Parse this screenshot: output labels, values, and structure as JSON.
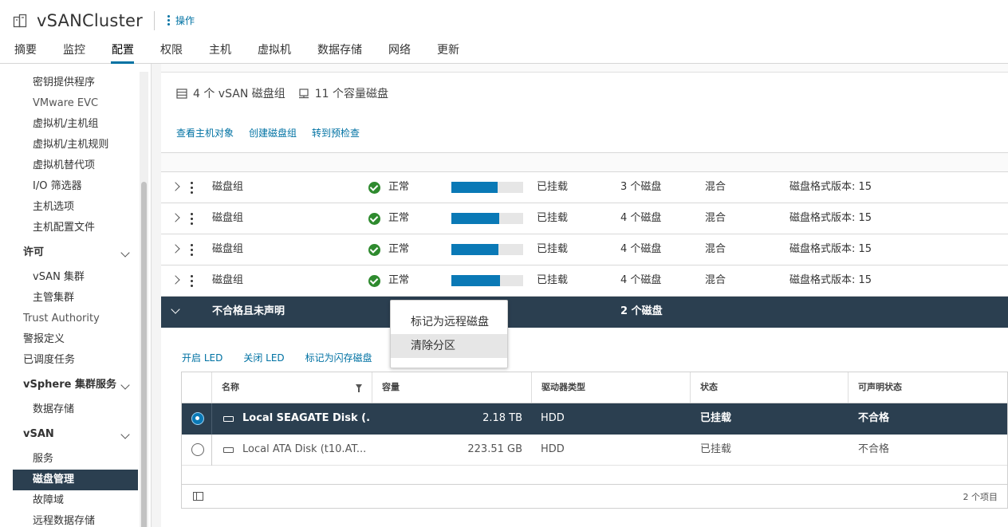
{
  "header": {
    "title": "vSANCluster",
    "actions_label": "操作",
    "tabs": [
      "摘要",
      "监控",
      "配置",
      "权限",
      "主机",
      "虚拟机",
      "数据存储",
      "网络",
      "更新"
    ],
    "active_tab": "配置"
  },
  "nav": {
    "items": [
      {
        "label": "密钥提供程序"
      },
      {
        "label": "VMware EVC"
      },
      {
        "label": "虚拟机/主机组"
      },
      {
        "label": "虚拟机/主机规则"
      },
      {
        "label": "虚拟机替代项"
      },
      {
        "label": "I/O 筛选器"
      },
      {
        "label": "主机选项"
      },
      {
        "label": "主机配置文件"
      },
      {
        "label": "许可"
      },
      {
        "label": "vSAN 集群"
      },
      {
        "label": "主管集群"
      },
      {
        "label": "Trust Authority"
      },
      {
        "label": "警报定义"
      },
      {
        "label": "已调度任务"
      },
      {
        "label": "vSphere 集群服务"
      },
      {
        "label": "数据存储"
      },
      {
        "label": "vSAN"
      },
      {
        "label": "服务"
      },
      {
        "label": "磁盘管理"
      },
      {
        "label": "故障域"
      },
      {
        "label": "远程数据存储"
      }
    ]
  },
  "summary": {
    "disk_groups": "4 个 vSAN 磁盘组",
    "capacity_disks": "11 个容量磁盘",
    "links": [
      "查看主机对象",
      "创建磁盘组",
      "转到预检查"
    ]
  },
  "disk_groups": [
    {
      "name": "磁盘组",
      "status": "正常",
      "usage": 0.64,
      "mounted": "已挂载",
      "disks": "3 个磁盘",
      "type": "混合",
      "format": "磁盘格式版本: 15"
    },
    {
      "name": "磁盘组",
      "status": "正常",
      "usage": 0.67,
      "mounted": "已挂载",
      "disks": "4 个磁盘",
      "type": "混合",
      "format": "磁盘格式版本: 15"
    },
    {
      "name": "磁盘组",
      "status": "正常",
      "usage": 0.66,
      "mounted": "已挂载",
      "disks": "4 个磁盘",
      "type": "混合",
      "format": "磁盘格式版本: 15"
    },
    {
      "name": "磁盘组",
      "status": "正常",
      "usage": 0.68,
      "mounted": "已挂载",
      "disks": "4 个磁盘",
      "type": "混合",
      "format": "磁盘格式版本: 15"
    }
  ],
  "ineligible": {
    "name": "不合格且未声明",
    "disks": "2 个磁盘",
    "actions": [
      "开启 LED",
      "关闭 LED",
      "标记为闪存磁盘"
    ],
    "columns": [
      "名称",
      "容量",
      "驱动器类型",
      "状态",
      "可声明状态"
    ],
    "rows": [
      {
        "name": "Local SEAGATE Disk (...",
        "capacity": "2.18 TB",
        "drive_type": "HDD",
        "state": "已挂载",
        "claim": "不合格",
        "selected": true
      },
      {
        "name": "Local ATA Disk (t10.AT...",
        "capacity": "223.51 GB",
        "drive_type": "HDD",
        "state": "已挂载",
        "claim": "不合格",
        "selected": false
      }
    ],
    "item_count": "2 个项目"
  },
  "context_menu": {
    "items": [
      "标记为远程磁盘",
      "清除分区"
    ],
    "hovered": "清除分区"
  },
  "colors": {
    "accent": "#0072a3",
    "selected_bg": "#2b3f50",
    "ok_green": "#2e8a2e",
    "bar_fill": "#0a79b6"
  }
}
